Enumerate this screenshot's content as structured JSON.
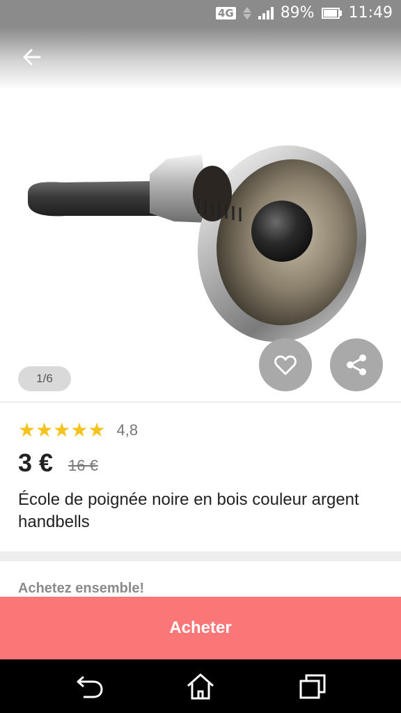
{
  "status_bar": {
    "network": "4G",
    "battery": "89%",
    "time": "11:49"
  },
  "icons": {
    "back": "arrow-left-icon",
    "favorite": "heart-icon",
    "share": "share-icon",
    "nav_back": "return-icon",
    "nav_home": "home-icon",
    "nav_recents": "recent-apps-icon"
  },
  "gallery": {
    "counter": "1/6"
  },
  "product": {
    "rating": "4,8",
    "stars": 5,
    "price": "3 €",
    "old_price": "16 €",
    "title": "École de poignée noire en bois couleur argent handbells"
  },
  "bundle": {
    "label": "Achetez ensemble!"
  },
  "actions": {
    "buy_label": "Acheter"
  },
  "colors": {
    "accent": "#fb7676",
    "star": "#f6c21c"
  }
}
